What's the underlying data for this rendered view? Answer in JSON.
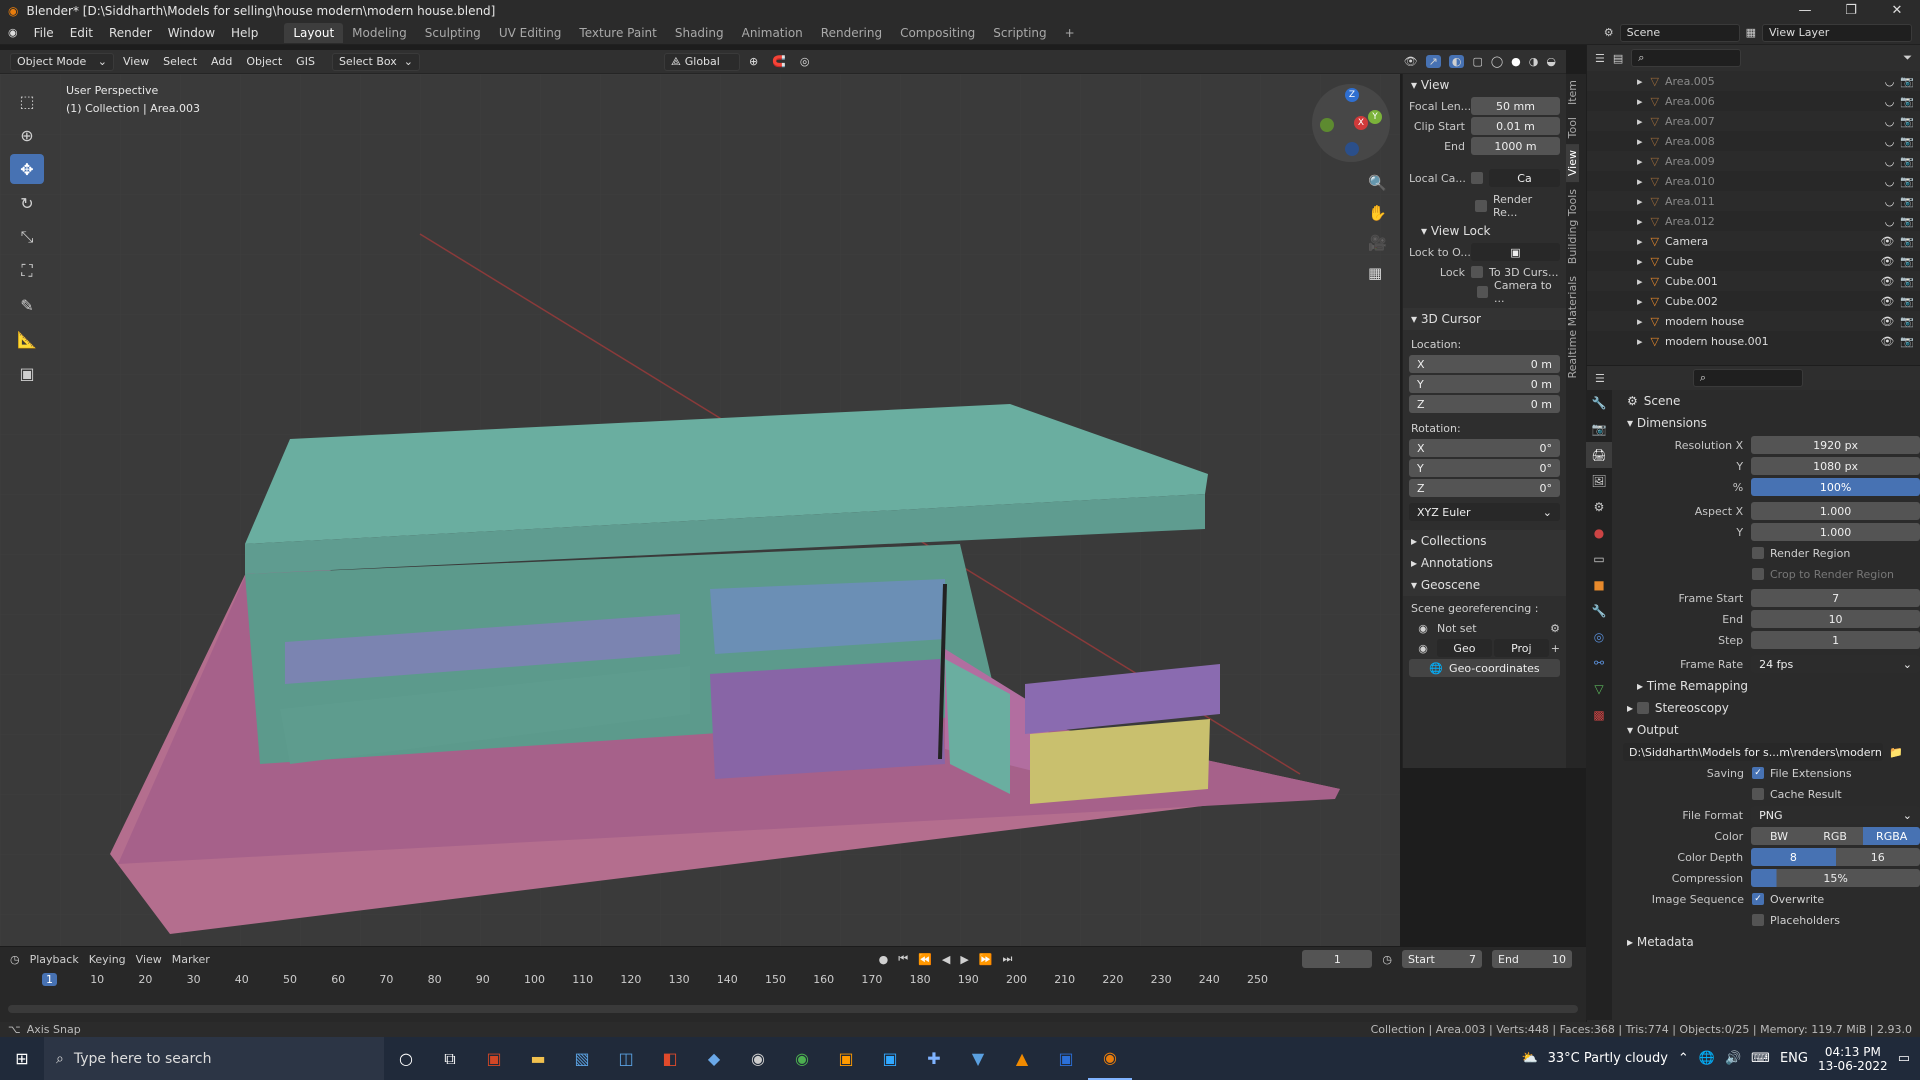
{
  "window": {
    "title": "Blender* [D:\\Siddharth\\Models for selling\\house modern\\modern house.blend]",
    "min": "—",
    "max": "❐",
    "close": "✕"
  },
  "menu": [
    "File",
    "Edit",
    "Render",
    "Window",
    "Help"
  ],
  "workspaces": [
    "Layout",
    "Modeling",
    "Sculpting",
    "UV Editing",
    "Texture Paint",
    "Shading",
    "Animation",
    "Rendering",
    "Compositing",
    "Scripting"
  ],
  "scene": {
    "label": "Scene",
    "view_layer": "View Layer"
  },
  "header3d": {
    "mode": "Object Mode",
    "view": "View",
    "select": "Select",
    "add": "Add",
    "object": "Object",
    "gis": "GIS",
    "select_box": "Select Box",
    "orientation": "Global"
  },
  "viewport": {
    "perspective": "User Perspective",
    "collection": "(1) Collection | Area.003"
  },
  "npanel": {
    "view_header": "View",
    "focal_label": "Focal Len...",
    "focal": "50 mm",
    "clip_start_label": "Clip Start",
    "clip_start": "0.01 m",
    "end_label": "End",
    "end": "1000 m",
    "local_cam_label": "Local Ca...",
    "local_cam_val": "Ca",
    "render_region": "Render Re...",
    "view_lock": "View Lock",
    "lock_to": "Lock to O...",
    "lock_label": "Lock",
    "to_3d_cursor": "To 3D Curs...",
    "camera_to": "Camera to ...",
    "cursor_header": "3D Cursor",
    "location": "Location:",
    "rotation": "Rotation:",
    "loc": {
      "x": "0 m",
      "y": "0 m",
      "z": "0 m"
    },
    "rot": {
      "x": "0°",
      "y": "0°",
      "z": "0°"
    },
    "axis": {
      "x": "X",
      "y": "Y",
      "z": "Z"
    },
    "euler": "XYZ Euler",
    "collections": "Collections",
    "annotations": "Annotations",
    "geoscene": "Geoscene",
    "georef": "Scene georeferencing :",
    "not_set": "Not set",
    "geo": "Geo",
    "proj": "Proj",
    "geocoords": "Geo-coordinates"
  },
  "vtabs": [
    "Item",
    "Tool",
    "View",
    "Building Tools",
    "Realtime Materials"
  ],
  "outliner": [
    {
      "name": "Area.005",
      "vis": false
    },
    {
      "name": "Area.006",
      "vis": false
    },
    {
      "name": "Area.007",
      "vis": false
    },
    {
      "name": "Area.008",
      "vis": false
    },
    {
      "name": "Area.009",
      "vis": false
    },
    {
      "name": "Area.010",
      "vis": false
    },
    {
      "name": "Area.011",
      "vis": false
    },
    {
      "name": "Area.012",
      "vis": false
    },
    {
      "name": "Camera",
      "vis": true
    },
    {
      "name": "Cube",
      "vis": true
    },
    {
      "name": "Cube.001",
      "vis": true
    },
    {
      "name": "Cube.002",
      "vis": true
    },
    {
      "name": "modern house",
      "vis": true
    },
    {
      "name": "modern house.001",
      "vis": true
    }
  ],
  "props": {
    "scene": "Scene",
    "dimensions": "Dimensions",
    "res_x_label": "Resolution X",
    "res_x": "1920 px",
    "y_label": "Y",
    "res_y": "1080 px",
    "pct_label": "%",
    "pct": "100%",
    "aspect_x_label": "Aspect X",
    "aspect_x": "1.000",
    "aspect_y": "1.000",
    "render_region": "Render Region",
    "crop": "Crop to Render Region",
    "frame_start_label": "Frame Start",
    "frame_start": "7",
    "end_label": "End",
    "frame_end": "10",
    "step_label": "Step",
    "step": "1",
    "rate_label": "Frame Rate",
    "rate": "24 fps",
    "time_remap": "Time Remapping",
    "stereoscopy": "Stereoscopy",
    "output": "Output",
    "path": "D:\\Siddharth\\Models for s...m\\renders\\modern house",
    "saving_label": "Saving",
    "file_ext": "File Extensions",
    "cache": "Cache Result",
    "format_label": "File Format",
    "format": "PNG",
    "color_label": "Color",
    "bw": "BW",
    "rgb": "RGB",
    "rgba": "RGBA",
    "depth_label": "Color Depth",
    "d8": "8",
    "d16": "16",
    "comp_label": "Compression",
    "comp": "15%",
    "seq_label": "Image Sequence",
    "overwrite": "Overwrite",
    "placeholders": "Placeholders",
    "metadata": "Metadata"
  },
  "timeline": {
    "playback": "Playback",
    "keying": "Keying",
    "view": "View",
    "marker": "Marker",
    "current": "1",
    "start_label": "Start",
    "start": "7",
    "end_label": "End",
    "end": "10",
    "ticks": [
      "1",
      "10",
      "20",
      "30",
      "40",
      "50",
      "60",
      "70",
      "80",
      "90",
      "100",
      "110",
      "120",
      "130",
      "140",
      "150",
      "160",
      "170",
      "180",
      "190",
      "200",
      "210",
      "220",
      "230",
      "240",
      "250"
    ]
  },
  "status": {
    "left": "Axis Snap",
    "right": "Collection | Area.003 | Verts:448 | Faces:368 | Tris:774 | Objects:0/25 | Memory: 119.7 MiB | 2.93.0"
  },
  "taskbar": {
    "search": "Type here to search",
    "weather": "33°C  Partly cloudy",
    "lang": "ENG",
    "time": "04:13 PM",
    "date": "13-06-2022"
  }
}
